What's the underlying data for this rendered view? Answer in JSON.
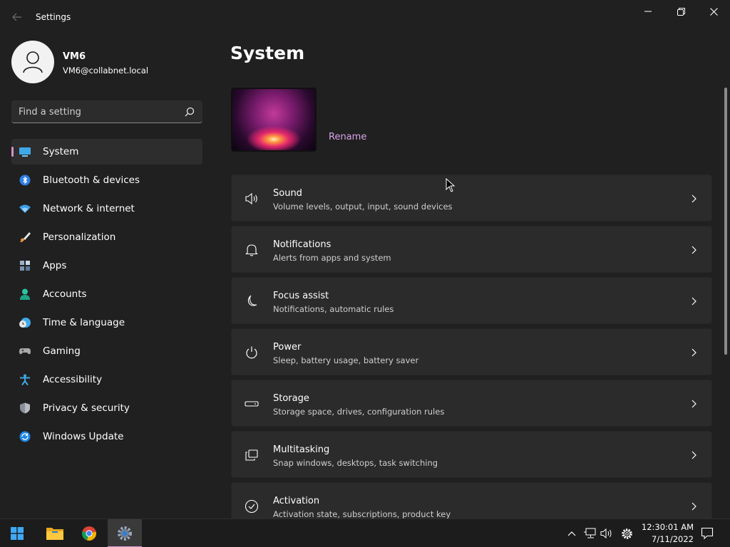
{
  "window": {
    "title": "Settings"
  },
  "profile": {
    "name": "VM6",
    "email": "VM6@collabnet.local"
  },
  "search": {
    "placeholder": "Find a setting"
  },
  "nav": {
    "items": [
      {
        "label": "System",
        "icon": "system-icon",
        "selected": true
      },
      {
        "label": "Bluetooth & devices",
        "icon": "bluetooth-icon"
      },
      {
        "label": "Network & internet",
        "icon": "wifi-icon"
      },
      {
        "label": "Personalization",
        "icon": "brush-icon"
      },
      {
        "label": "Apps",
        "icon": "apps-icon"
      },
      {
        "label": "Accounts",
        "icon": "accounts-icon"
      },
      {
        "label": "Time & language",
        "icon": "time-language-icon"
      },
      {
        "label": "Gaming",
        "icon": "gamepad-icon"
      },
      {
        "label": "Accessibility",
        "icon": "accessibility-icon"
      },
      {
        "label": "Privacy & security",
        "icon": "shield-icon"
      },
      {
        "label": "Windows Update",
        "icon": "update-icon"
      }
    ]
  },
  "main": {
    "title": "System",
    "rename_label": "Rename",
    "cards": [
      {
        "title": "Sound",
        "subtitle": "Volume levels, output, input, sound devices",
        "icon": "speaker-icon"
      },
      {
        "title": "Notifications",
        "subtitle": "Alerts from apps and system",
        "icon": "bell-icon"
      },
      {
        "title": "Focus assist",
        "subtitle": "Notifications, automatic rules",
        "icon": "moon-icon"
      },
      {
        "title": "Power",
        "subtitle": "Sleep, battery usage, battery saver",
        "icon": "power-icon"
      },
      {
        "title": "Storage",
        "subtitle": "Storage space, drives, configuration rules",
        "icon": "storage-icon"
      },
      {
        "title": "Multitasking",
        "subtitle": "Snap windows, desktops, task switching",
        "icon": "multitasking-icon"
      },
      {
        "title": "Activation",
        "subtitle": "Activation state, subscriptions, product key",
        "icon": "check-circle-icon"
      }
    ]
  },
  "taskbar": {
    "time": "12:30:01 AM",
    "date": "7/11/2022"
  },
  "colors": {
    "accent": "#d291cf",
    "link": "#d7a4e8",
    "background": "#202020",
    "card": "#2b2b2b"
  }
}
